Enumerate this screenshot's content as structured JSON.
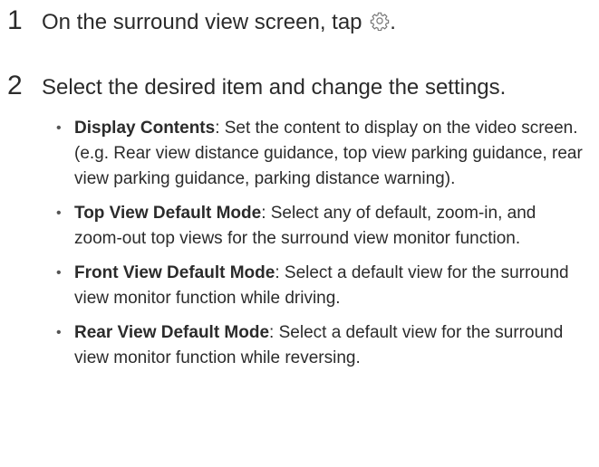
{
  "step1": {
    "number": "1",
    "text": "On the surround view screen, tap",
    "icon": "gear-icon",
    "suffix": "."
  },
  "step2": {
    "number": "2",
    "text": "Select the desired item and change the settings."
  },
  "items": [
    {
      "term": "Display Contents",
      "description": ": Set the content to display on the video screen.",
      "example": "(e.g. Rear view distance guidance, top view parking guidance, rear view parking guidance, parking distance warning)."
    },
    {
      "term": "Top View Default Mode",
      "description": ": Select any of default, zoom-in, and zoom-out top views for the surround view monitor function."
    },
    {
      "term": "Front View Default Mode",
      "description": ": Select a default view for the surround view monitor function while driving."
    },
    {
      "term": "Rear View Default Mode",
      "description": ": Select a default view for the surround view monitor function while reversing."
    }
  ]
}
